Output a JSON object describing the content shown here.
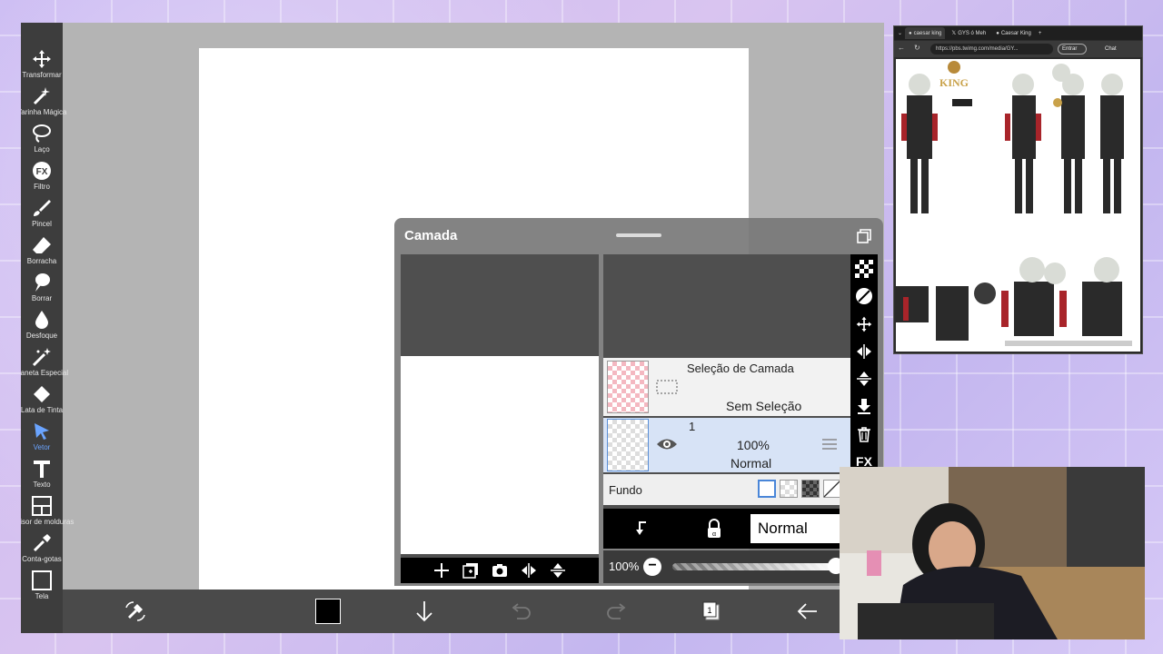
{
  "tools": [
    {
      "label": "Transformar",
      "icon": "move-icon"
    },
    {
      "label": "Varinha Mágica",
      "icon": "magic-wand-icon"
    },
    {
      "label": "Laço",
      "icon": "lasso-icon"
    },
    {
      "label": "Filtro",
      "icon": "fx-icon"
    },
    {
      "label": "Pincel",
      "icon": "brush-icon"
    },
    {
      "label": "Borracha",
      "icon": "eraser-icon"
    },
    {
      "label": "Borrar",
      "icon": "smudge-icon"
    },
    {
      "label": "Desfoque",
      "icon": "blur-icon"
    },
    {
      "label": "Caneta Especial",
      "icon": "special-pen-icon"
    },
    {
      "label": "Lata de Tinta",
      "icon": "paint-bucket-icon"
    },
    {
      "label": "Vetor",
      "icon": "vector-cursor-icon"
    },
    {
      "label": "Texto",
      "icon": "text-icon"
    },
    {
      "label": "Divisor de molduras",
      "icon": "frame-divider-icon"
    },
    {
      "label": "Conta-gotas",
      "icon": "eyedropper-icon"
    },
    {
      "label": "Tela",
      "icon": "canvas-icon"
    }
  ],
  "active_tool_index": 10,
  "layer_panel": {
    "title": "Camada",
    "selection_layer": {
      "name": "Seleção de Camada",
      "status": "Sem Seleção"
    },
    "layer_1": {
      "number": "1",
      "opacity": "100%",
      "blend": "Normal"
    },
    "fundo_label": "Fundo",
    "blend_mode": "Normal",
    "opacity_label": "100%",
    "opacity_value": 1.0,
    "fx_label": "FX"
  },
  "browser": {
    "tabs": [
      "caesar king",
      "GYS ó Meh",
      "Caesar King"
    ],
    "url": "https://pbs.twimg.com/media/GY...",
    "login_label": "Entrar",
    "chat_label": "Chat"
  },
  "reference_texts": {
    "logo": "KING"
  },
  "colors": {
    "toolbar_bg": "#3d3d3d",
    "active_tool": "#6aa4ff",
    "current_color": "#000000"
  }
}
